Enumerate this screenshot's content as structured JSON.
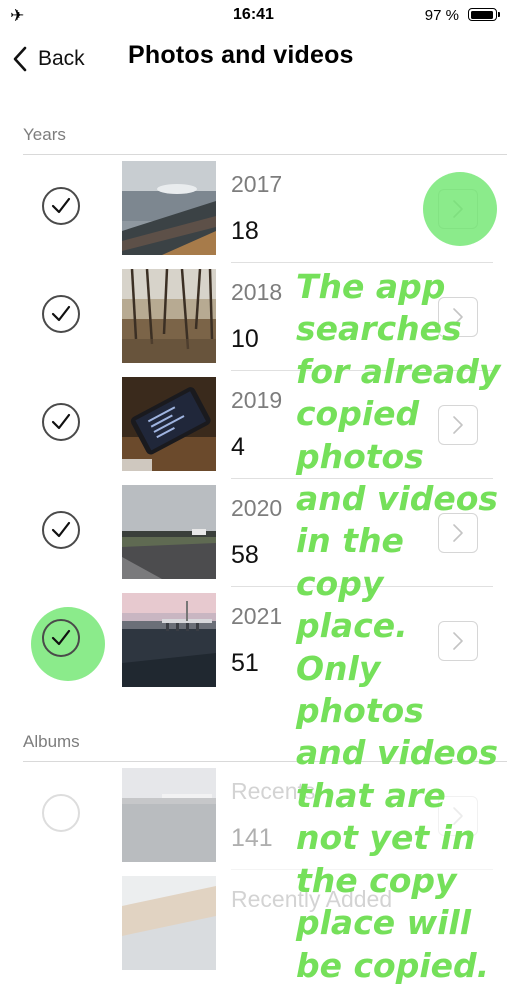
{
  "status_bar": {
    "time": "16:41",
    "battery": "97 %",
    "battery_level": 0.97
  },
  "nav": {
    "back_label": "Back",
    "title": "Photos and videos"
  },
  "sections": {
    "years_header": "Years",
    "albums_header": "Albums"
  },
  "years": [
    {
      "year": "2017",
      "count": "18",
      "selected": true
    },
    {
      "year": "2018",
      "count": "10",
      "selected": true
    },
    {
      "year": "2019",
      "count": "4",
      "selected": true
    },
    {
      "year": "2020",
      "count": "58",
      "selected": true
    },
    {
      "year": "2021",
      "count": "51",
      "selected": true
    }
  ],
  "albums": [
    {
      "name": "Recents",
      "count": "141",
      "selected": false
    },
    {
      "name": "Recently Added",
      "count": "",
      "selected": false
    }
  ],
  "annotation": "The app searches for already copied photos and videos in the copy place. Only photos and videos that are not yet in the copy place will be copied.",
  "colors": {
    "highlight": "#6ee66e",
    "annotation_text": "#75e05a"
  }
}
